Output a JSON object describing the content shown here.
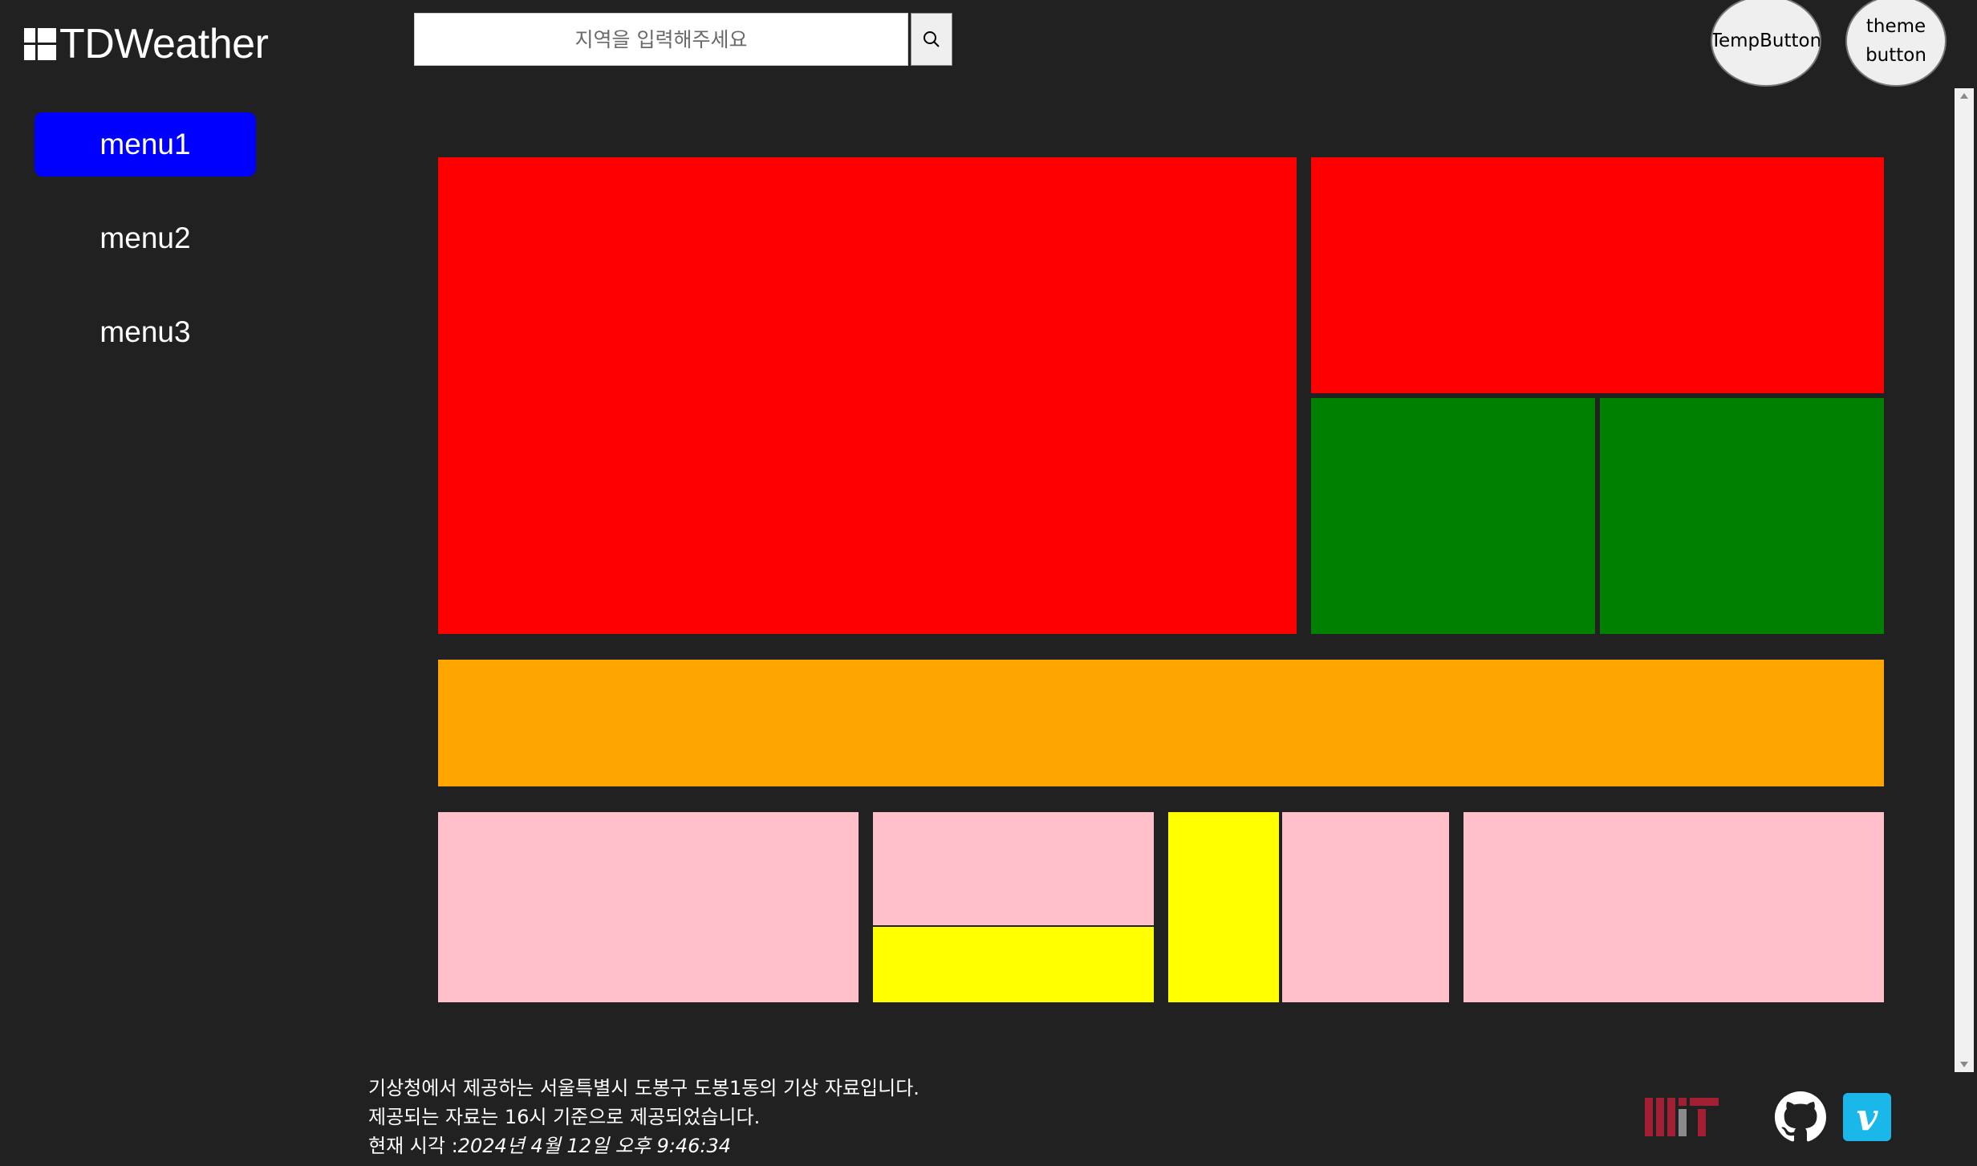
{
  "app": {
    "title": "TDWeather"
  },
  "search": {
    "placeholder": "지역을 입력해주세요"
  },
  "header": {
    "temp_button": "TempButton",
    "theme_button_line1": "theme",
    "theme_button_line2": "button"
  },
  "menu": {
    "items": [
      {
        "label": "menu1"
      },
      {
        "label": "menu2"
      },
      {
        "label": "menu3"
      }
    ]
  },
  "colors": {
    "background": "#212121",
    "menu_active": "#0000ff",
    "block_red": "#ff0000",
    "block_green": "#008000",
    "block_orange": "#ffa500",
    "block_pink": "#ffc0cb",
    "block_yellow": "#ffff00",
    "vimeo": "#1ab7ea"
  },
  "footer": {
    "line1": "기상청에서 제공하는 서울특별시 도봉구 도봉1동의 기상 자료입니다.",
    "line2": "제공되는 자료는 16시 기준으로 제공되었습니다.",
    "time_label": "현재 시각 :",
    "time_value": "2024년 4월 12일 오후 9:46:34",
    "icons": [
      "mit-logo-icon",
      "github-icon",
      "vimeo-icon"
    ],
    "vimeo_letter": "v"
  }
}
